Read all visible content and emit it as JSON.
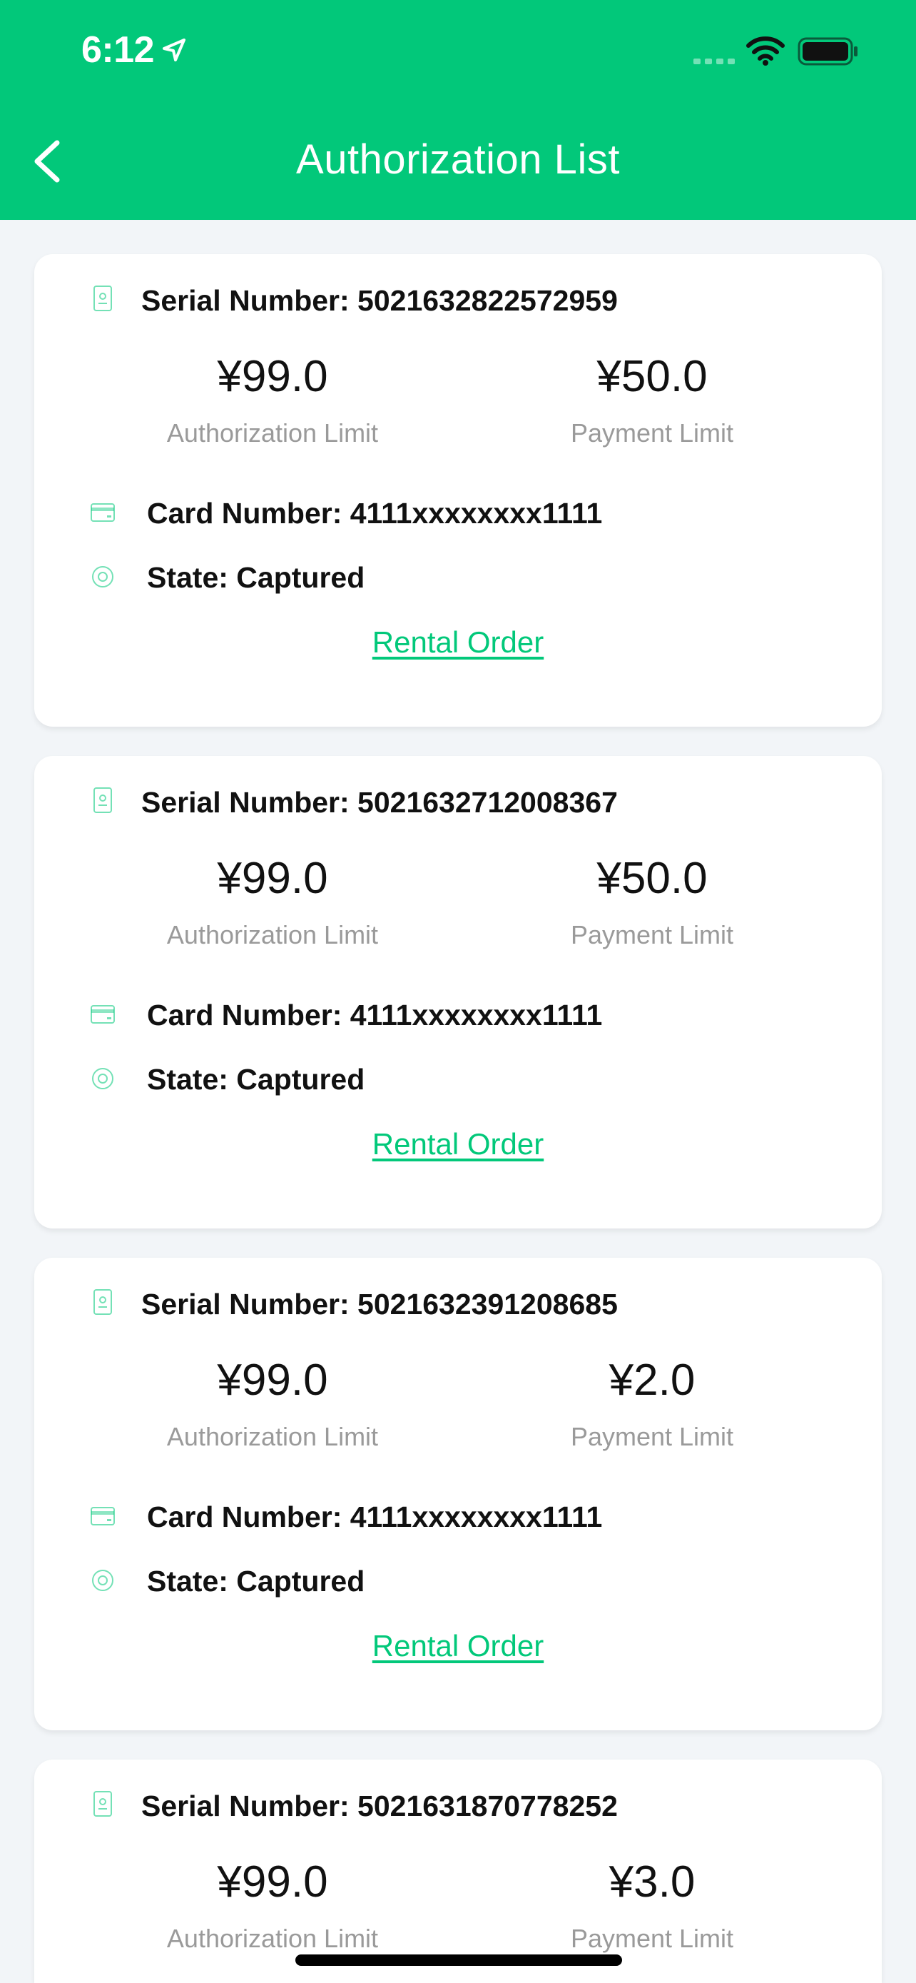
{
  "status_bar": {
    "time": "6:12"
  },
  "header": {
    "title": "Authorization List"
  },
  "colors": {
    "accent": "#02c87a",
    "background": "#f2f5f8",
    "text": "#111111",
    "muted": "#9a9a9a"
  },
  "icons": [
    "location-arrow-icon",
    "signal-icon",
    "wifi-icon",
    "battery-icon",
    "chevron-left-icon",
    "serial-doc-icon",
    "credit-card-icon",
    "state-target-icon"
  ],
  "cards": [
    {
      "serial": "Serial Number: 5021632822572959",
      "auth_amount": "¥99.0",
      "auth_label": "Authorization Limit",
      "pay_amount": "¥50.0",
      "pay_label": "Payment Limit",
      "card": "Card Number: 4111xxxxxxxx1111",
      "state": "State: Captured",
      "link": "Rental Order"
    },
    {
      "serial": "Serial Number: 5021632712008367",
      "auth_amount": "¥99.0",
      "auth_label": "Authorization Limit",
      "pay_amount": "¥50.0",
      "pay_label": "Payment Limit",
      "card": "Card Number: 4111xxxxxxxx1111",
      "state": "State: Captured",
      "link": "Rental Order"
    },
    {
      "serial": "Serial Number: 5021632391208685",
      "auth_amount": "¥99.0",
      "auth_label": "Authorization Limit",
      "pay_amount": "¥2.0",
      "pay_label": "Payment Limit",
      "card": "Card Number: 4111xxxxxxxx1111",
      "state": "State: Captured",
      "link": "Rental Order"
    },
    {
      "serial": "Serial Number: 5021631870778252",
      "auth_amount": "¥99.0",
      "auth_label": "Authorization Limit",
      "pay_amount": "¥3.0",
      "pay_label": "Payment Limit"
    }
  ]
}
